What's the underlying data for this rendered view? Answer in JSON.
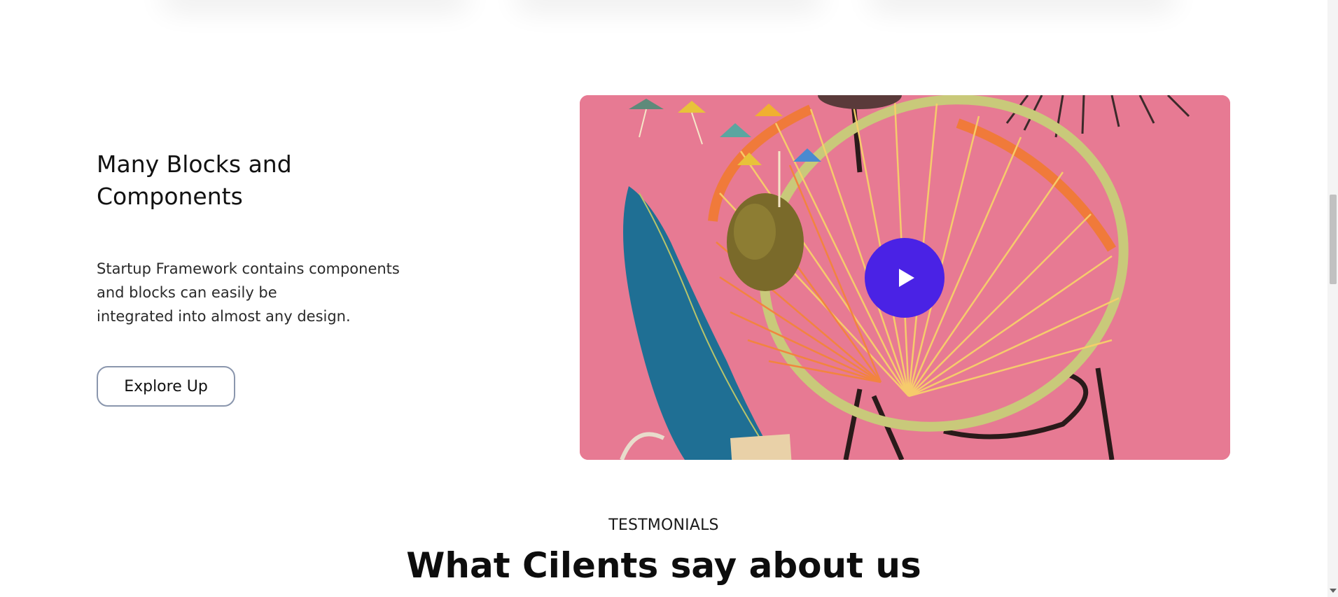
{
  "feature": {
    "title": "Many Blocks and Components",
    "description_lines": [
      "Startup Framework contains components",
      "and blocks can easily be",
      "integrated into almost any design."
    ],
    "cta_label": "Explore Up"
  },
  "media": {
    "play_icon": "play-icon",
    "play_color": "#4a22e5",
    "background_color": "#e77a93"
  },
  "testimonials": {
    "eyebrow": "TESTMONIALS",
    "title": "What Cilents say about us"
  }
}
